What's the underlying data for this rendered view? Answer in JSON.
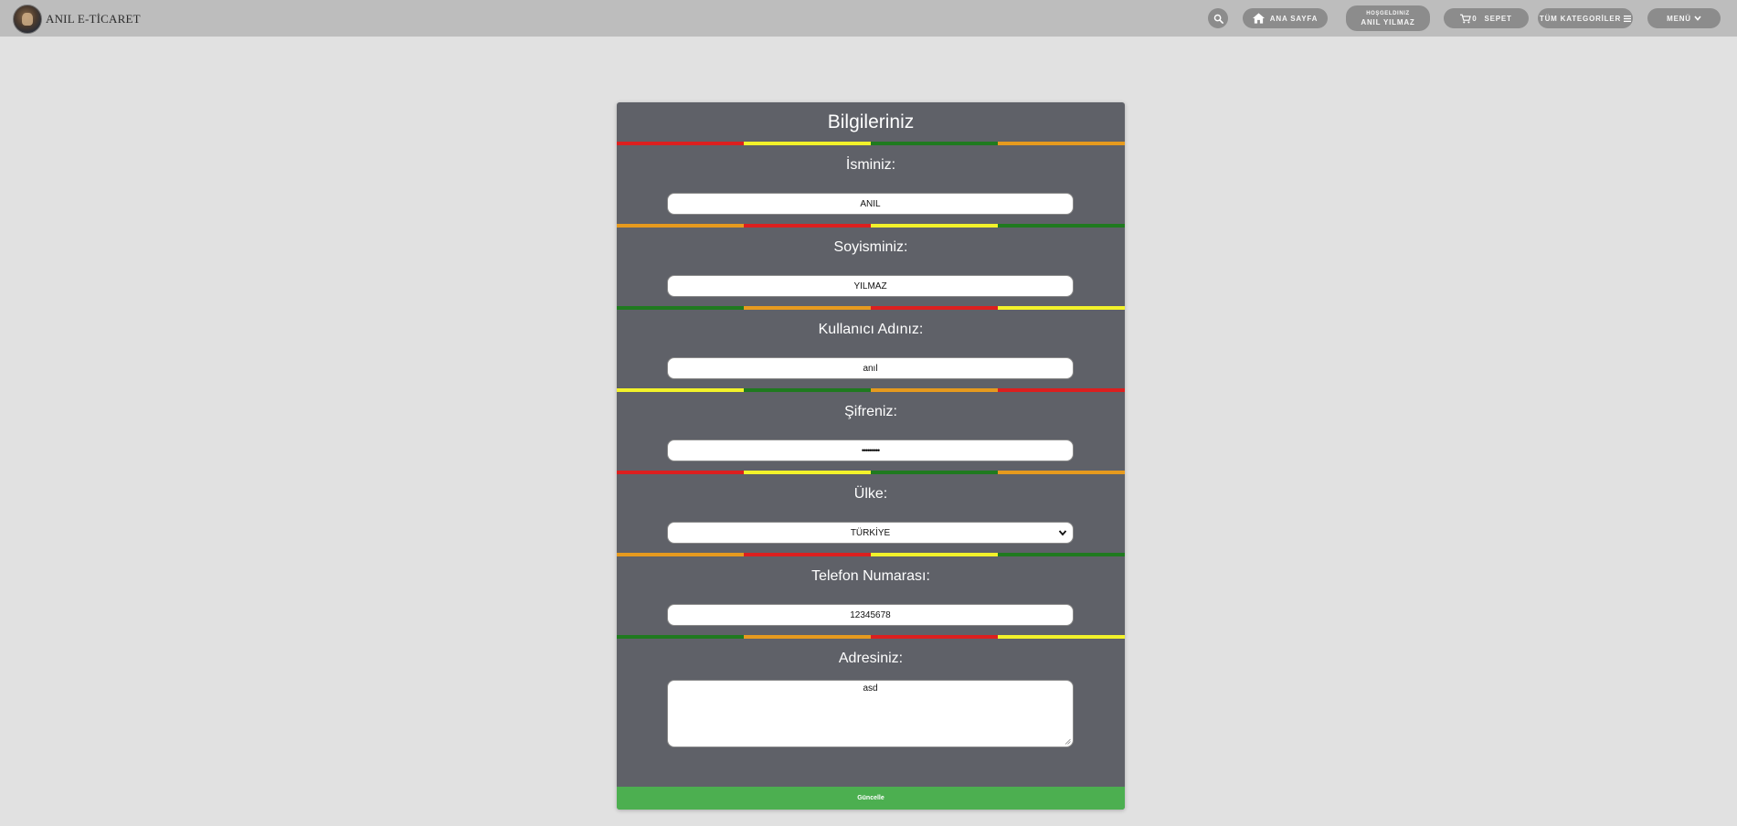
{
  "header": {
    "brand_name": "ANIL E-TİCARET",
    "logo_icon": "brand-logo",
    "nav": {
      "search_icon": "search-icon",
      "home_label": "ANA SAYFA",
      "user_greeting": "HOŞGELDINIZ",
      "user_name": "ANIL YILMAZ",
      "cart_count": "0",
      "cart_label": "SEPET",
      "categories_label": "TÜM KATEGORİLER",
      "menu_label": "MENÜ"
    }
  },
  "form": {
    "title": "Bilgileriniz",
    "fields": {
      "first_name": {
        "label": "İsminiz:",
        "value": "ANIL"
      },
      "last_name": {
        "label": "Soyisminiz:",
        "value": "YILMAZ"
      },
      "username": {
        "label": "Kullanıcı Adınız:",
        "value": "anıl"
      },
      "password": {
        "label": "Şifreniz:",
        "value": "•••••••••"
      },
      "country": {
        "label": "Ülke:",
        "value": "TÜRKİYE"
      },
      "phone": {
        "label": "Telefon Numarası:",
        "value": "12345678"
      },
      "address": {
        "label": "Adresiniz:",
        "value": "asd"
      }
    },
    "submit_label": "Güncelle"
  },
  "colors": {
    "page_bg": "#e1e1e1",
    "topbar_bg": "#bdbdbd",
    "pill_bg": "#8c8c8c",
    "card_bg": "#5f6168",
    "submit_bg": "#4caf50",
    "stripe_red": "#dc1f1f",
    "stripe_yellow": "#f2f22a",
    "stripe_green": "#1f7a1f",
    "stripe_orange": "#e69a1e"
  }
}
